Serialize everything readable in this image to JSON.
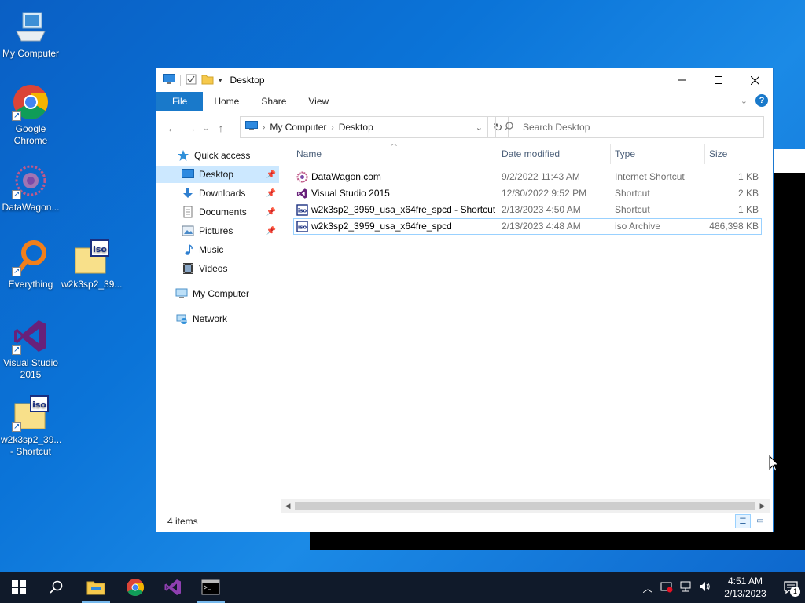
{
  "desktop": {
    "icons": [
      {
        "label": "My Computer",
        "icon": "monitor-icon"
      },
      {
        "label": "Google Chrome",
        "icon": "chrome-icon",
        "shortcut": true
      },
      {
        "label": "DataWagon...",
        "icon": "datawagon-icon",
        "shortcut": true
      },
      {
        "label": "Everything",
        "icon": "everything-icon",
        "shortcut": true
      },
      {
        "label": "w2k3sp2_39...",
        "icon": "iso-icon"
      },
      {
        "label": "Visual Studio 2015",
        "icon": "visual-studio-icon",
        "shortcut": true
      },
      {
        "label": "w2k3sp2_39... - Shortcut",
        "icon": "iso-icon",
        "shortcut": true
      }
    ]
  },
  "window": {
    "title": "Desktop",
    "ribbon_tabs": [
      "File",
      "Home",
      "Share",
      "View"
    ],
    "address": {
      "crumbs": [
        "My Computer",
        "Desktop"
      ]
    },
    "search": {
      "placeholder": "Search Desktop"
    },
    "nav": {
      "quick_access": "Quick access",
      "items": [
        {
          "label": "Desktop",
          "pinned": true,
          "selected": true
        },
        {
          "label": "Downloads",
          "pinned": true
        },
        {
          "label": "Documents",
          "pinned": true
        },
        {
          "label": "Pictures",
          "pinned": true
        },
        {
          "label": "Music"
        },
        {
          "label": "Videos"
        }
      ],
      "my_computer": "My Computer",
      "network": "Network"
    },
    "columns": {
      "name": "Name",
      "date": "Date modified",
      "type": "Type",
      "size": "Size"
    },
    "files": [
      {
        "name": "DataWagon.com",
        "date": "9/2/2022 11:43 AM",
        "type": "Internet Shortcut",
        "size": "1 KB"
      },
      {
        "name": "Visual Studio 2015",
        "date": "12/30/2022 9:52 PM",
        "type": "Shortcut",
        "size": "2 KB"
      },
      {
        "name": "w2k3sp2_3959_usa_x64fre_spcd - Shortcut",
        "date": "2/13/2023 4:50 AM",
        "type": "Shortcut",
        "size": "1 KB"
      },
      {
        "name": "w2k3sp2_3959_usa_x64fre_spcd",
        "date": "2/13/2023 4:48 AM",
        "type": "iso Archive",
        "size": "486,398 KB"
      }
    ],
    "status": "4 items"
  },
  "taskbar": {
    "time": "4:51 AM",
    "date": "2/13/2023",
    "notification_count": "1"
  },
  "colors": {
    "accent": "#1979ca",
    "taskbar": "#101a2a",
    "selection": "#cce8ff"
  }
}
